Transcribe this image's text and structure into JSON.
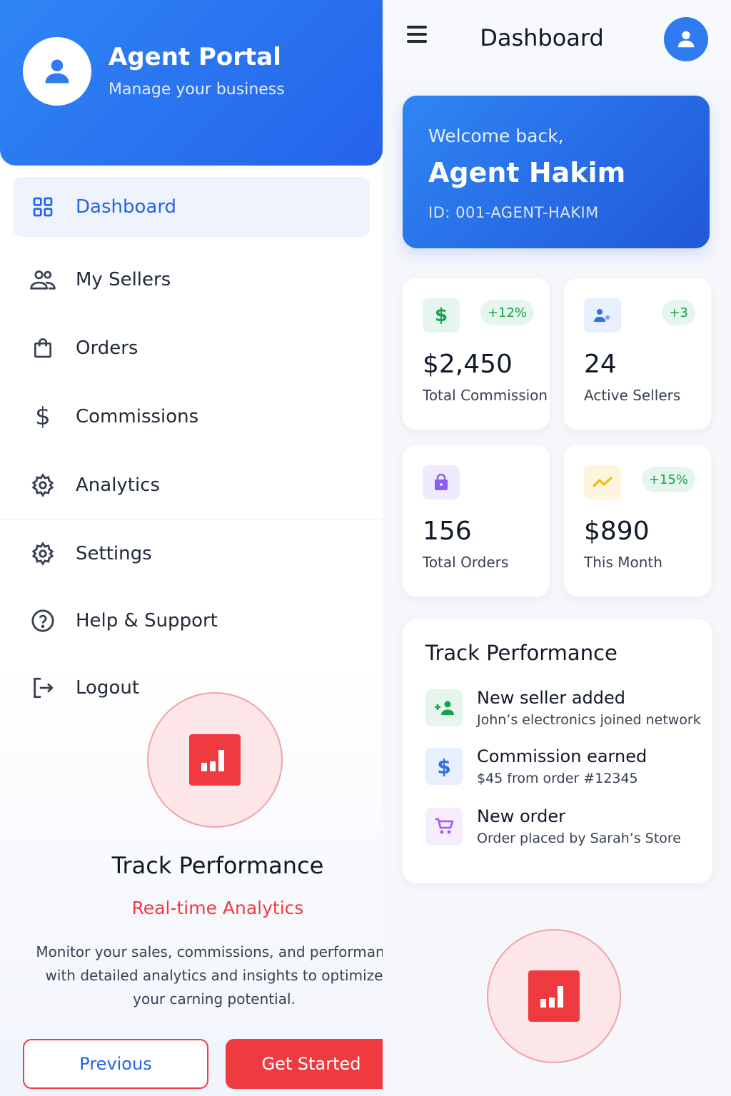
{
  "drawer": {
    "title": "Agent Portal",
    "subtitle": "Manage your business",
    "avatar_icon": "user-icon",
    "items": [
      {
        "label": "Dashboard",
        "icon": "grid-icon",
        "active": true
      },
      {
        "label": "My Sellers",
        "icon": "users-icon"
      },
      {
        "label": "Orders",
        "icon": "shopping-bag-icon"
      },
      {
        "label": "Commissions",
        "icon": "dollar-icon"
      },
      {
        "label": "Analytics",
        "icon": "gear-icon"
      }
    ],
    "lower_items": [
      {
        "label": "Settings",
        "icon": "gear-icon"
      },
      {
        "label": "Help & Support",
        "icon": "help-circle-icon"
      },
      {
        "label": "Logout",
        "icon": "logout-icon"
      }
    ]
  },
  "onboarding": {
    "icon": "bar-chart-icon",
    "title": "Track Performance",
    "subtitle": "Real-time Analytics",
    "description_lines": [
      "Monitor your sales, commissions, and performanc",
      "with detailed analytics and insights to optimize",
      "your carning potential."
    ],
    "previous_label": "Previous",
    "start_label": "Get Started"
  },
  "topbar": {
    "title": "Dashboard",
    "menu_icon": "menu-icon",
    "profile_icon": "user-icon"
  },
  "welcome": {
    "greeting": "Welcome back,",
    "name": "Agent Hakim",
    "id": "ID: 001-AGENT-HAKIM"
  },
  "stats": [
    {
      "value": "$2,450",
      "label": "Total Commission",
      "badge": "+12%",
      "icon": "dollar-icon",
      "icon_bg": "#e6f6ee",
      "icon_color": "#16a34a"
    },
    {
      "value": "24",
      "label": "Active Sellers",
      "badge": "+3",
      "icon": "user-add-icon",
      "icon_bg": "#e8efff",
      "icon_color": "#2f6fe0"
    },
    {
      "value": "156",
      "label": "Total Orders",
      "badge": "",
      "icon": "lock-bag-icon",
      "icon_bg": "#efeafd",
      "icon_color": "#8b5cf6"
    },
    {
      "value": "$890",
      "label": "This Month",
      "badge": "+15%",
      "icon": "trend-icon",
      "icon_bg": "#fff5df",
      "icon_color": "#f5b500"
    }
  ],
  "activity": {
    "title": "Track Performance",
    "items": [
      {
        "title": "New seller added",
        "subtitle": "John’s electronics joined network",
        "icon": "user-plus-icon",
        "icon_bg": "#e6f6ee",
        "icon_color": "#16a34a"
      },
      {
        "title": "Commission earned",
        "subtitle": "$45 from order #12345",
        "icon": "dollar-icon",
        "icon_bg": "#e8efff",
        "icon_color": "#2f6fe0"
      },
      {
        "title": "New order",
        "subtitle": "Order placed by Sarah’s Store",
        "icon": "cart-icon",
        "icon_bg": "#f5ecfd",
        "icon_color": "#a855f7"
      }
    ]
  },
  "colors": {
    "primary": "#2563eb",
    "accent_red": "#ef3b40",
    "success": "#16a34a"
  }
}
